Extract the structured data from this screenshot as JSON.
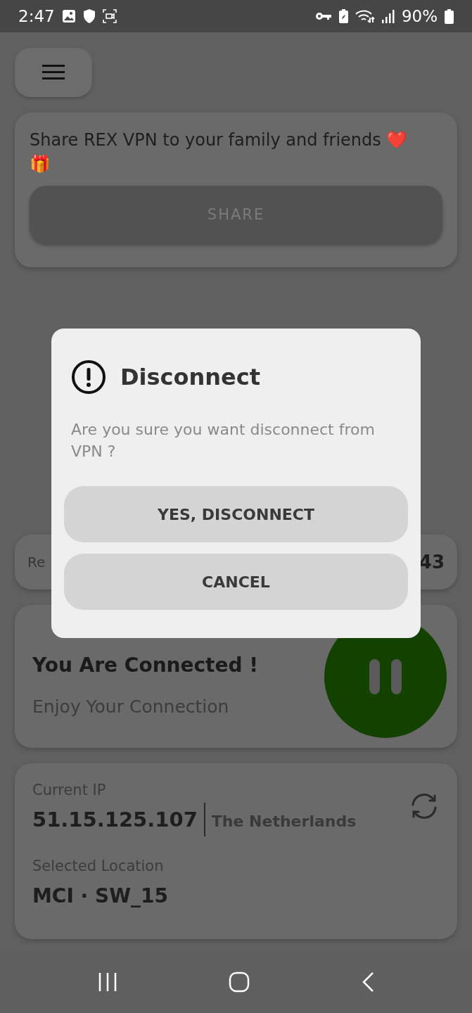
{
  "status_bar": {
    "time": "2:47",
    "battery": "90%"
  },
  "share_card": {
    "message": "Share REX VPN to your family and friends ❤️ 🎁",
    "button": "SHARE"
  },
  "remaining_row": {
    "label": "Re",
    "value": "43"
  },
  "connection_card": {
    "title": "You Are Connected !",
    "subtitle": "Enjoy Your Connection",
    "connected": true
  },
  "ip_card": {
    "ip_label": "Current IP",
    "ip": "51.15.125.107",
    "country": "The Netherlands",
    "location_label": "Selected Location",
    "location": "MCI · SW_15"
  },
  "dialog": {
    "title": "Disconnect",
    "message": "Are you sure you want disconnect from VPN ?",
    "buttons": [
      "YES, DISCONNECT",
      "CANCEL"
    ]
  }
}
